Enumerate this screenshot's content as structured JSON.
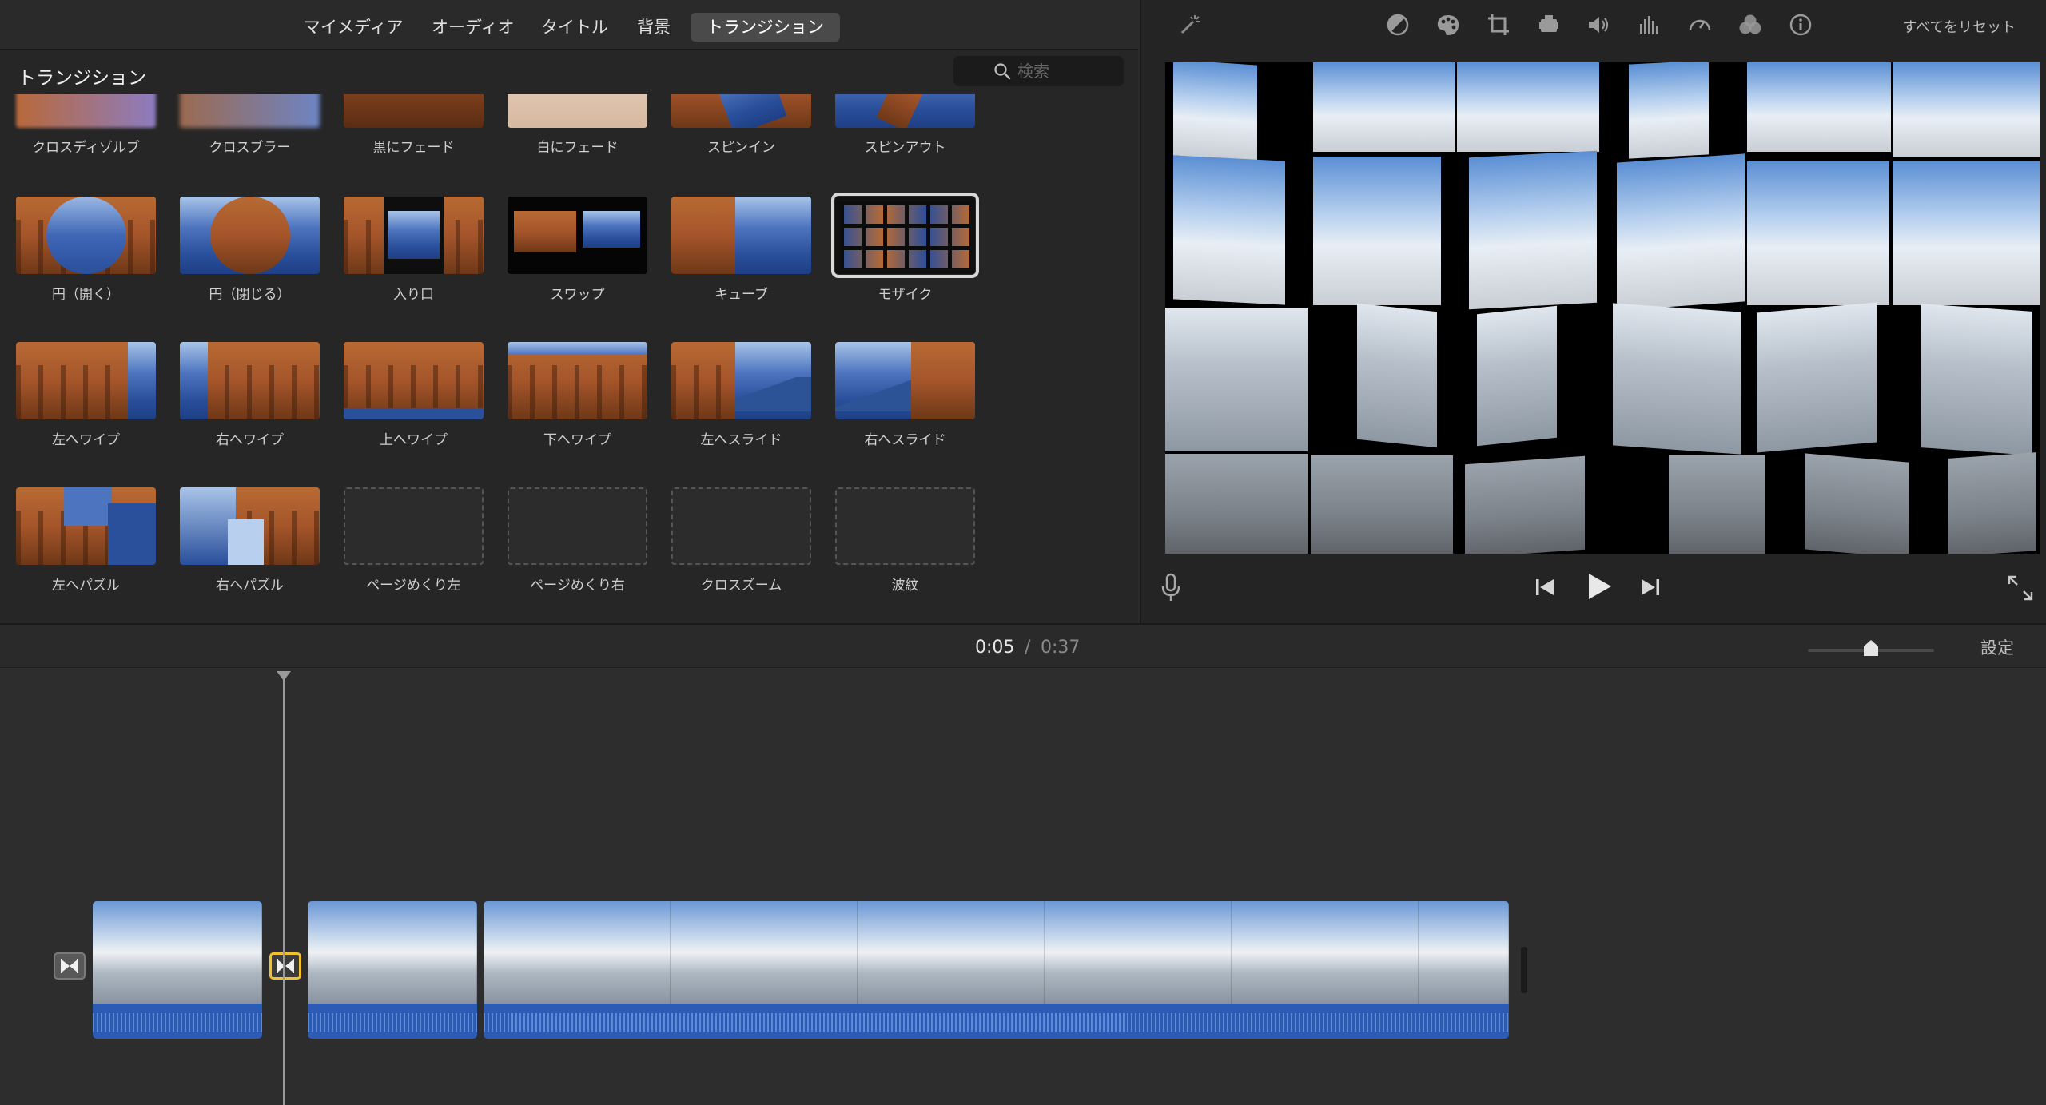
{
  "browser": {
    "tabs": [
      {
        "label": "マイメディア",
        "active": false
      },
      {
        "label": "オーディオ",
        "active": false
      },
      {
        "label": "タイトル",
        "active": false
      },
      {
        "label": "背景",
        "active": false
      },
      {
        "label": "トランジション",
        "active": true
      }
    ],
    "panel_title": "トランジション",
    "search": {
      "placeholder": "検索",
      "value": ""
    },
    "transitions": [
      {
        "label": "クロスディゾルブ"
      },
      {
        "label": "クロスブラー"
      },
      {
        "label": "黒にフェード"
      },
      {
        "label": "白にフェード"
      },
      {
        "label": "スピンイン"
      },
      {
        "label": "スピンアウト"
      },
      {
        "label": "円（開く）"
      },
      {
        "label": "円（閉じる）"
      },
      {
        "label": "入り口"
      },
      {
        "label": "スワップ"
      },
      {
        "label": "キューブ"
      },
      {
        "label": "モザイク",
        "selected": true
      },
      {
        "label": "左へワイプ"
      },
      {
        "label": "右へワイプ"
      },
      {
        "label": "上へワイプ"
      },
      {
        "label": "下へワイプ"
      },
      {
        "label": "左へスライド"
      },
      {
        "label": "右へスライド"
      },
      {
        "label": "左へパズル"
      },
      {
        "label": "右へパズル"
      },
      {
        "label": "ページめくり左",
        "placeholder": true
      },
      {
        "label": "ページめくり右",
        "placeholder": true
      },
      {
        "label": "クロスズーム",
        "placeholder": true
      },
      {
        "label": "波紋",
        "placeholder": true
      }
    ]
  },
  "viewer": {
    "toolbar_icons": [
      "magic-wand-icon",
      "color-balance-icon",
      "color-correction-icon",
      "crop-icon",
      "stabilization-icon",
      "volume-icon",
      "noise-reduction-equalizer-icon",
      "speed-icon",
      "clip-filter-icon",
      "info-icon"
    ],
    "reset_all_label": "すべてをリセット",
    "controls": [
      "microphone-icon",
      "skip-back-icon",
      "play-icon",
      "skip-forward-icon",
      "fullscreen-icon"
    ]
  },
  "timeline": {
    "current_time": "0:05",
    "separator": "/",
    "total_time": "0:37",
    "settings_label": "設定",
    "zoom_level": 0.5
  },
  "colors": {
    "accent_selected_transition": "#f2c12e",
    "clip_audio_blue": "#2b5bb5",
    "panel_bg": "#262626"
  }
}
